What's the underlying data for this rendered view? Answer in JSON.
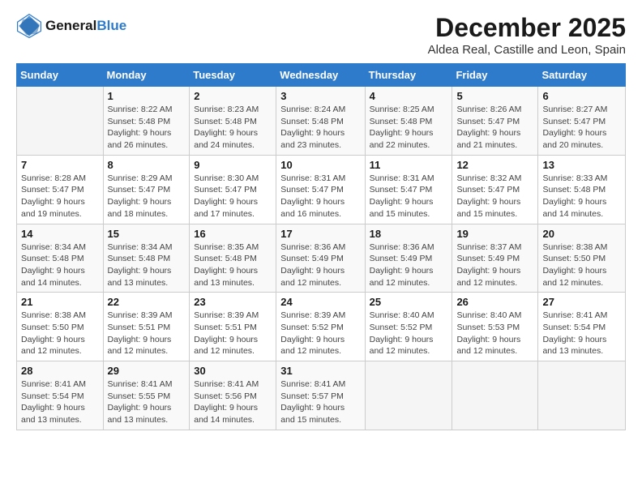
{
  "logo": {
    "text_general": "General",
    "text_blue": "Blue"
  },
  "header": {
    "month_year": "December 2025",
    "location": "Aldea Real, Castille and Leon, Spain"
  },
  "weekdays": [
    "Sunday",
    "Monday",
    "Tuesday",
    "Wednesday",
    "Thursday",
    "Friday",
    "Saturday"
  ],
  "weeks": [
    [
      {
        "day": "",
        "info": ""
      },
      {
        "day": "1",
        "info": "Sunrise: 8:22 AM\nSunset: 5:48 PM\nDaylight: 9 hours\nand 26 minutes."
      },
      {
        "day": "2",
        "info": "Sunrise: 8:23 AM\nSunset: 5:48 PM\nDaylight: 9 hours\nand 24 minutes."
      },
      {
        "day": "3",
        "info": "Sunrise: 8:24 AM\nSunset: 5:48 PM\nDaylight: 9 hours\nand 23 minutes."
      },
      {
        "day": "4",
        "info": "Sunrise: 8:25 AM\nSunset: 5:48 PM\nDaylight: 9 hours\nand 22 minutes."
      },
      {
        "day": "5",
        "info": "Sunrise: 8:26 AM\nSunset: 5:47 PM\nDaylight: 9 hours\nand 21 minutes."
      },
      {
        "day": "6",
        "info": "Sunrise: 8:27 AM\nSunset: 5:47 PM\nDaylight: 9 hours\nand 20 minutes."
      }
    ],
    [
      {
        "day": "7",
        "info": "Sunrise: 8:28 AM\nSunset: 5:47 PM\nDaylight: 9 hours\nand 19 minutes."
      },
      {
        "day": "8",
        "info": "Sunrise: 8:29 AM\nSunset: 5:47 PM\nDaylight: 9 hours\nand 18 minutes."
      },
      {
        "day": "9",
        "info": "Sunrise: 8:30 AM\nSunset: 5:47 PM\nDaylight: 9 hours\nand 17 minutes."
      },
      {
        "day": "10",
        "info": "Sunrise: 8:31 AM\nSunset: 5:47 PM\nDaylight: 9 hours\nand 16 minutes."
      },
      {
        "day": "11",
        "info": "Sunrise: 8:31 AM\nSunset: 5:47 PM\nDaylight: 9 hours\nand 15 minutes."
      },
      {
        "day": "12",
        "info": "Sunrise: 8:32 AM\nSunset: 5:47 PM\nDaylight: 9 hours\nand 15 minutes."
      },
      {
        "day": "13",
        "info": "Sunrise: 8:33 AM\nSunset: 5:48 PM\nDaylight: 9 hours\nand 14 minutes."
      }
    ],
    [
      {
        "day": "14",
        "info": "Sunrise: 8:34 AM\nSunset: 5:48 PM\nDaylight: 9 hours\nand 14 minutes."
      },
      {
        "day": "15",
        "info": "Sunrise: 8:34 AM\nSunset: 5:48 PM\nDaylight: 9 hours\nand 13 minutes."
      },
      {
        "day": "16",
        "info": "Sunrise: 8:35 AM\nSunset: 5:48 PM\nDaylight: 9 hours\nand 13 minutes."
      },
      {
        "day": "17",
        "info": "Sunrise: 8:36 AM\nSunset: 5:49 PM\nDaylight: 9 hours\nand 12 minutes."
      },
      {
        "day": "18",
        "info": "Sunrise: 8:36 AM\nSunset: 5:49 PM\nDaylight: 9 hours\nand 12 minutes."
      },
      {
        "day": "19",
        "info": "Sunrise: 8:37 AM\nSunset: 5:49 PM\nDaylight: 9 hours\nand 12 minutes."
      },
      {
        "day": "20",
        "info": "Sunrise: 8:38 AM\nSunset: 5:50 PM\nDaylight: 9 hours\nand 12 minutes."
      }
    ],
    [
      {
        "day": "21",
        "info": "Sunrise: 8:38 AM\nSunset: 5:50 PM\nDaylight: 9 hours\nand 12 minutes."
      },
      {
        "day": "22",
        "info": "Sunrise: 8:39 AM\nSunset: 5:51 PM\nDaylight: 9 hours\nand 12 minutes."
      },
      {
        "day": "23",
        "info": "Sunrise: 8:39 AM\nSunset: 5:51 PM\nDaylight: 9 hours\nand 12 minutes."
      },
      {
        "day": "24",
        "info": "Sunrise: 8:39 AM\nSunset: 5:52 PM\nDaylight: 9 hours\nand 12 minutes."
      },
      {
        "day": "25",
        "info": "Sunrise: 8:40 AM\nSunset: 5:52 PM\nDaylight: 9 hours\nand 12 minutes."
      },
      {
        "day": "26",
        "info": "Sunrise: 8:40 AM\nSunset: 5:53 PM\nDaylight: 9 hours\nand 12 minutes."
      },
      {
        "day": "27",
        "info": "Sunrise: 8:41 AM\nSunset: 5:54 PM\nDaylight: 9 hours\nand 13 minutes."
      }
    ],
    [
      {
        "day": "28",
        "info": "Sunrise: 8:41 AM\nSunset: 5:54 PM\nDaylight: 9 hours\nand 13 minutes."
      },
      {
        "day": "29",
        "info": "Sunrise: 8:41 AM\nSunset: 5:55 PM\nDaylight: 9 hours\nand 13 minutes."
      },
      {
        "day": "30",
        "info": "Sunrise: 8:41 AM\nSunset: 5:56 PM\nDaylight: 9 hours\nand 14 minutes."
      },
      {
        "day": "31",
        "info": "Sunrise: 8:41 AM\nSunset: 5:57 PM\nDaylight: 9 hours\nand 15 minutes."
      },
      {
        "day": "",
        "info": ""
      },
      {
        "day": "",
        "info": ""
      },
      {
        "day": "",
        "info": ""
      }
    ]
  ]
}
